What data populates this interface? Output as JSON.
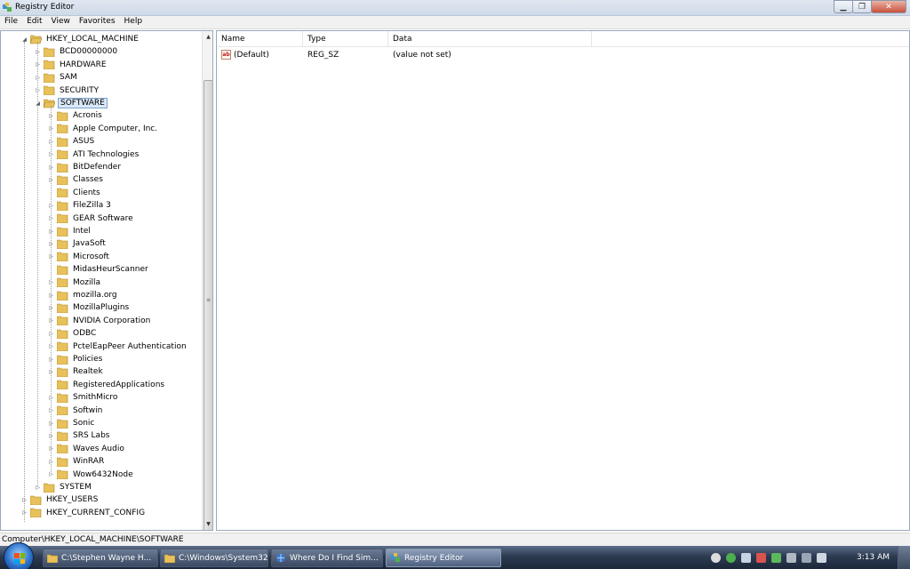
{
  "window": {
    "title": "Registry Editor",
    "buttons": {
      "minimize": "▁",
      "maximize": "❐",
      "close": "✕"
    }
  },
  "menu": [
    "File",
    "Edit",
    "View",
    "Favorites",
    "Help"
  ],
  "tree": {
    "root": "HKEY_LOCAL_MACHINE",
    "hklm_children": [
      "BCD00000000",
      "HARDWARE",
      "SAM",
      "SECURITY",
      "SOFTWARE"
    ],
    "selected": "SOFTWARE",
    "software_children": [
      "Acronis",
      "Apple Computer, Inc.",
      "ASUS",
      "ATI Technologies",
      "BitDefender",
      "Classes",
      "Clients",
      "FileZilla 3",
      "GEAR Software",
      "Intel",
      "JavaSoft",
      "Microsoft",
      "MidasHeurScanner",
      "Mozilla",
      "mozilla.org",
      "MozillaPlugins",
      "NVIDIA Corporation",
      "ODBC",
      "PctelEapPeer Authentication",
      "Policies",
      "Realtek",
      "RegisteredApplications",
      "SmithMicro",
      "Softwin",
      "Sonic",
      "SRS Labs",
      "Waves Audio",
      "WinRAR",
      "Wow6432Node"
    ],
    "after_software": [
      "SYSTEM"
    ],
    "other_roots": [
      "HKEY_USERS",
      "HKEY_CURRENT_CONFIG"
    ]
  },
  "list": {
    "columns": [
      "Name",
      "Type",
      "Data"
    ],
    "rows": [
      {
        "name": "(Default)",
        "type": "REG_SZ",
        "data": "(value not set)"
      }
    ]
  },
  "status": "Computer\\HKEY_LOCAL_MACHINE\\SOFTWARE",
  "taskbar": {
    "items": [
      {
        "label": "C:\\Stephen Wayne H...",
        "icon": "folder-icon"
      },
      {
        "label": "C:\\Windows\\System32",
        "icon": "folder-icon"
      },
      {
        "label": "Where Do I Find Sim...",
        "icon": "browser-icon"
      },
      {
        "label": "Registry Editor",
        "icon": "regedit-icon"
      }
    ],
    "clock": "3:13 AM"
  },
  "colors": {
    "folder": "#e8c15a",
    "selection": "#d9e8f9",
    "taskbar": "#2d3b52"
  }
}
